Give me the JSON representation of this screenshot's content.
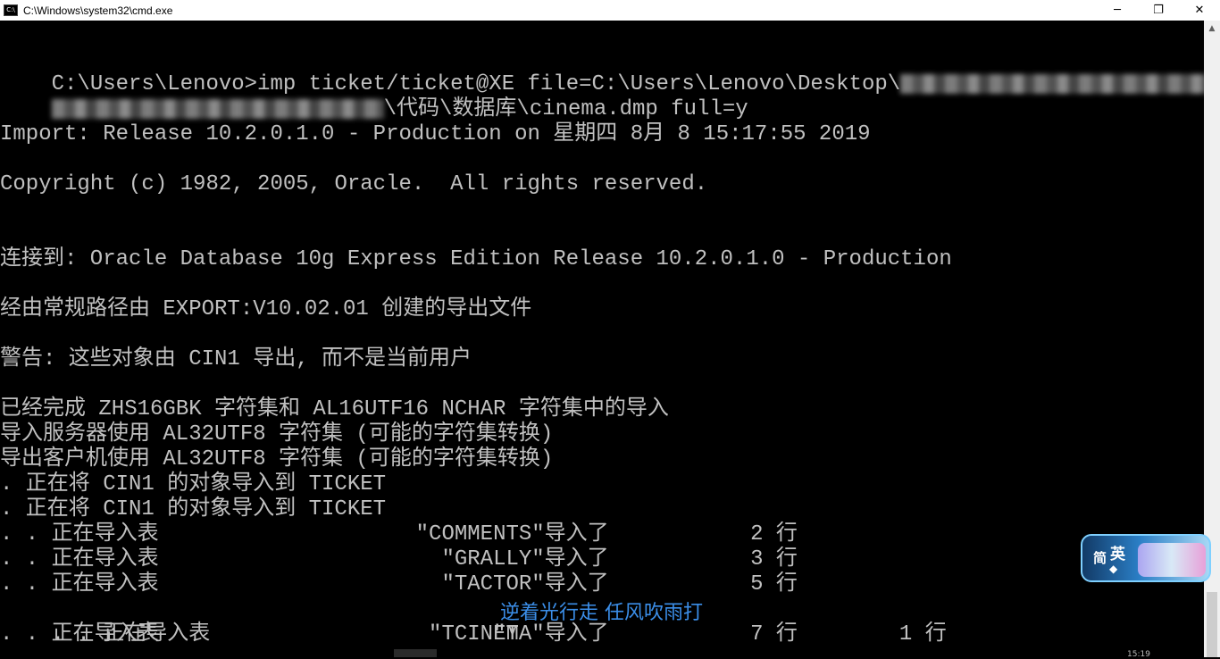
{
  "window": {
    "title": "C:\\Windows\\system32\\cmd.exe",
    "icon_text": "C:\\",
    "minimize": "─",
    "maximize": "❐",
    "close": "✕"
  },
  "console": {
    "lines": [
      "C:\\Users\\Lenovo>imp ticket/ticket@XE file=C:\\Users\\Lenovo\\Desktop\\",
      "\\代码\\数据库\\cinema.dmp full=y",
      "Import: Release 10.2.0.1.0 - Production on 星期四 8月 8 15:17:55 2019",
      "Copyright (c) 1982, 2005, Oracle.  All rights reserved.",
      "连接到: Oracle Database 10g Express Edition Release 10.2.0.1.0 - Production",
      "经由常规路径由 EXPORT:V10.02.01 创建的导出文件",
      "警告: 这些对象由 CIN1 导出, 而不是当前用户",
      "已经完成 ZHS16GBK 字符集和 AL16UTF16 NCHAR 字符集中的导入",
      "导入服务器使用 AL32UTF8 字符集 (可能的字符集转换)",
      "导出客户机使用 AL32UTF8 字符集 (可能的字符集转换)",
      ". 正在将 CIN1 的对象导入到 TICKET",
      ". 正在将 CIN1 的对象导入到 TICKET",
      ". . 正在导入表                    \"COMMENTS\"导入了           2 行",
      ". . 正在导入表                      \"GRALLY\"导入了           3 行",
      ". . 正在导入表                      \"TACTOR\"导入了           5 行",
      ". . 正在导入表                      \"T",
      "               1 行",
      ". . 正在导入表                     \"TCINEMA\"导入了           7 行"
    ]
  },
  "ime": {
    "mode_simplified": "简",
    "mode_english": "英",
    "dot": "◆"
  },
  "lyric": "逆着光行走 任风吹雨打",
  "clock_fragment": "15:19"
}
